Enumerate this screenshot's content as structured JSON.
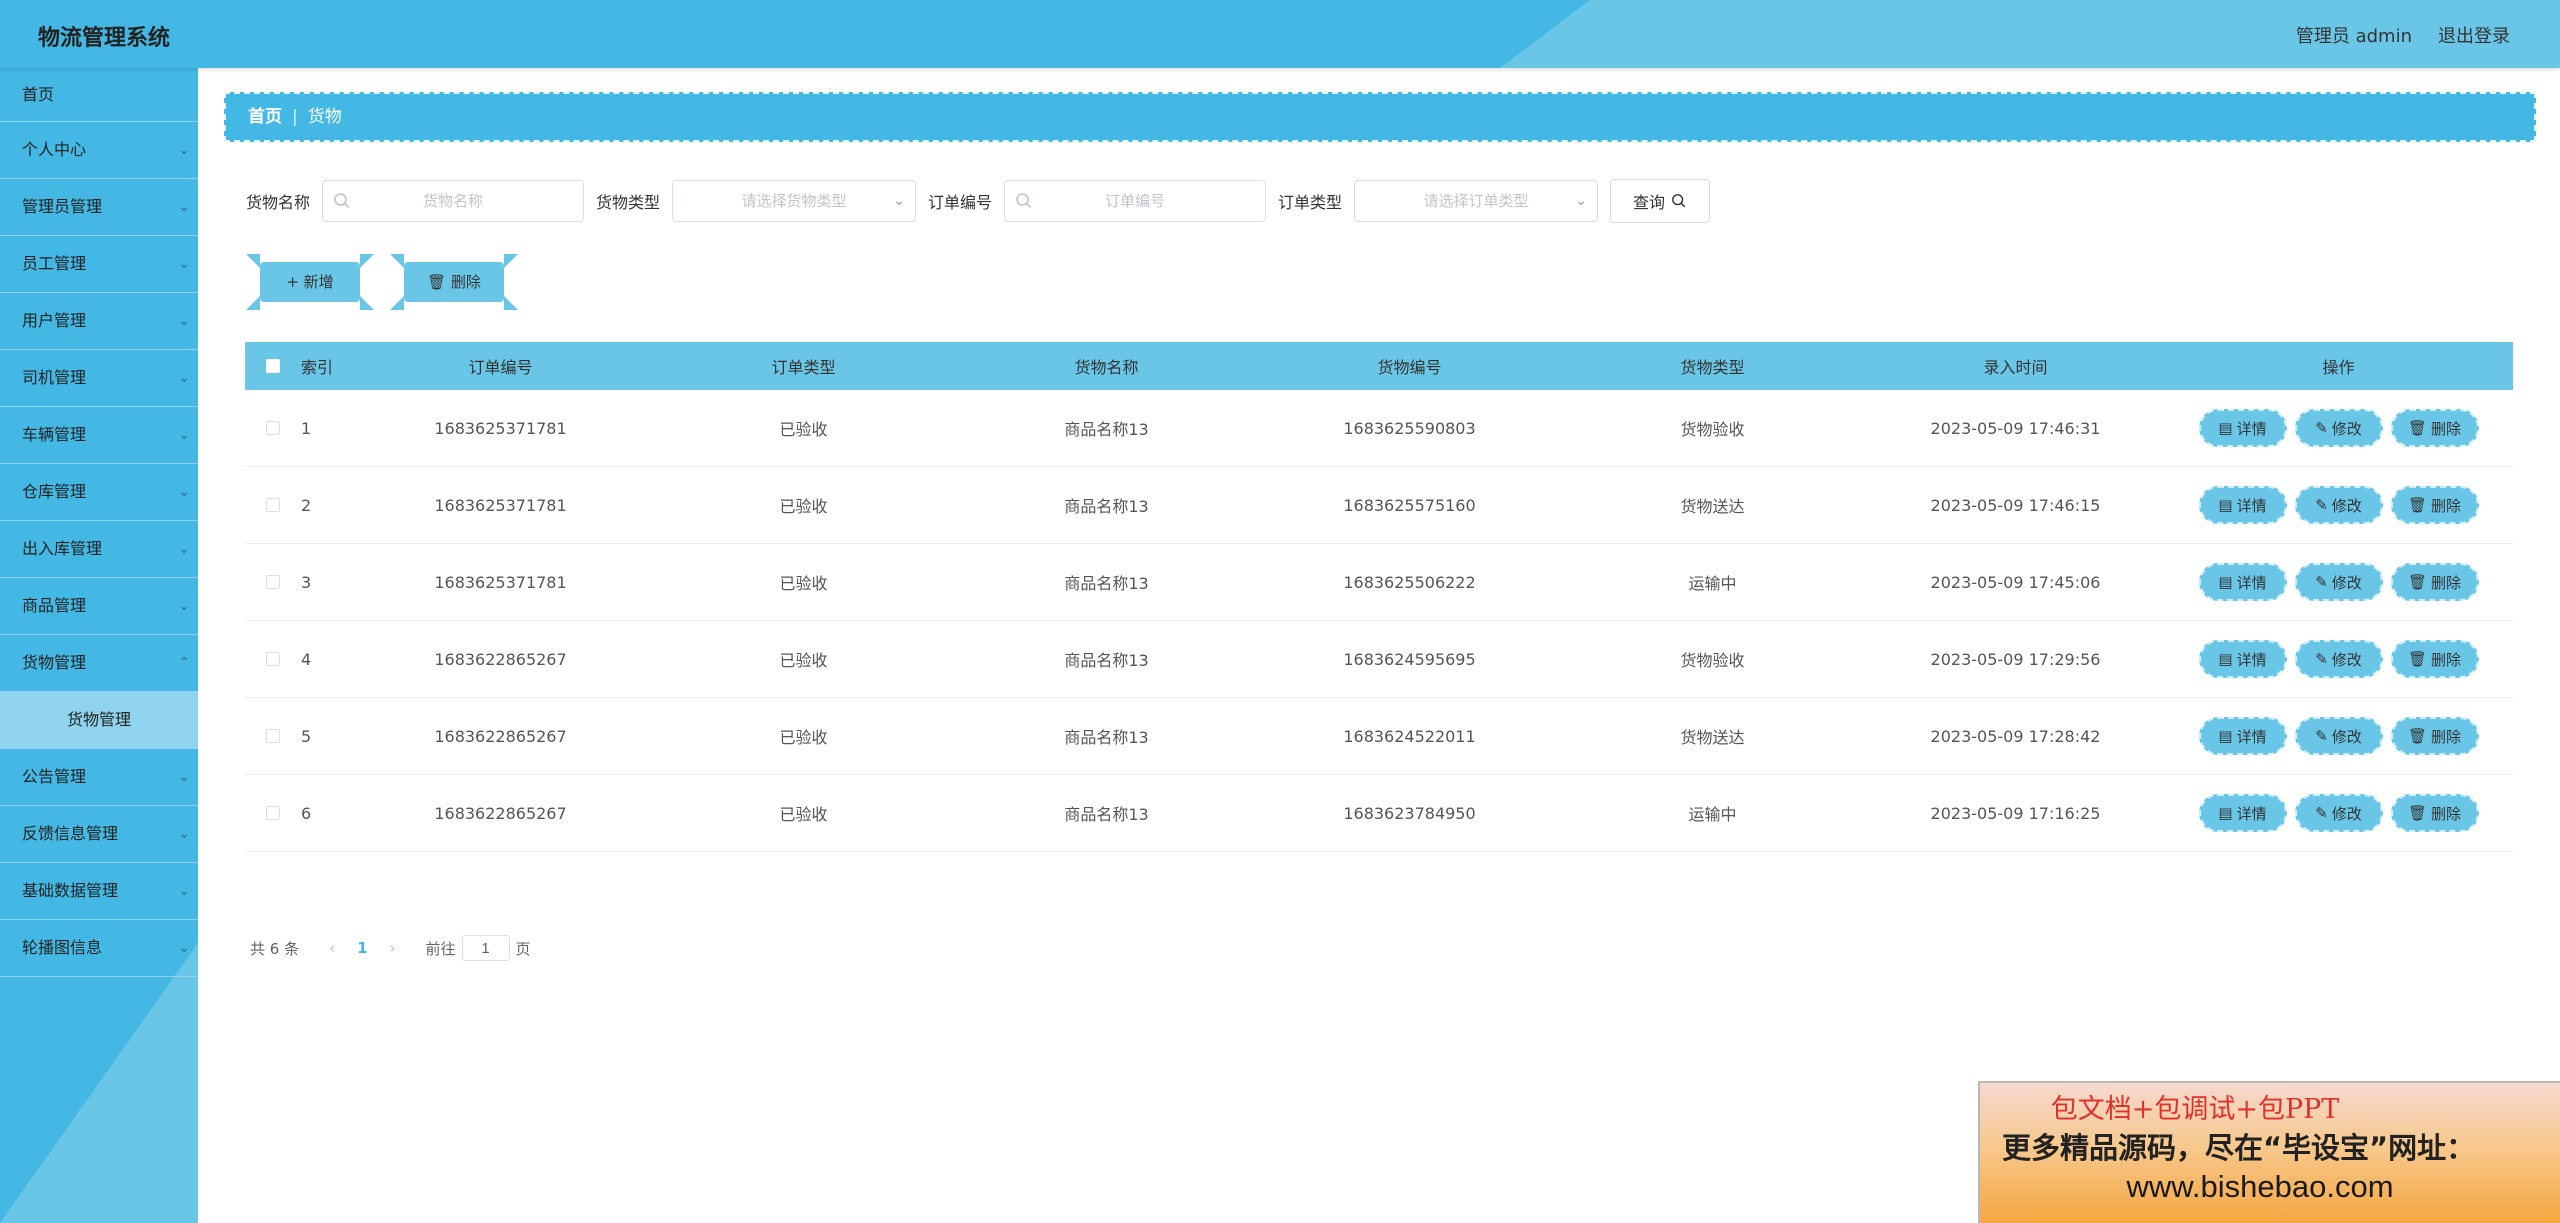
{
  "header": {
    "title": "物流管理系统",
    "user": "管理员 admin",
    "logout": "退出登录"
  },
  "sidebar": {
    "items": [
      {
        "label": "首页"
      },
      {
        "label": "个人中心"
      },
      {
        "label": "管理员管理"
      },
      {
        "label": "员工管理"
      },
      {
        "label": "用户管理"
      },
      {
        "label": "司机管理"
      },
      {
        "label": "车辆管理"
      },
      {
        "label": "仓库管理"
      },
      {
        "label": "出入库管理"
      },
      {
        "label": "商品管理"
      },
      {
        "label": "货物管理"
      },
      {
        "label": "公告管理"
      },
      {
        "label": "反馈信息管理"
      },
      {
        "label": "基础数据管理"
      },
      {
        "label": "轮播图信息"
      }
    ],
    "active_sub": "货物管理"
  },
  "breadcrumb": {
    "home": "首页",
    "current": "货物"
  },
  "filters": {
    "goods_name_label": "货物名称",
    "goods_name_placeholder": "货物名称",
    "goods_type_label": "货物类型",
    "goods_type_placeholder": "请选择货物类型",
    "order_no_label": "订单编号",
    "order_no_placeholder": "订单编号",
    "order_type_label": "订单类型",
    "order_type_placeholder": "请选择订单类型",
    "query_label": "查询"
  },
  "actions": {
    "add": "新增",
    "delete": "删除"
  },
  "table": {
    "columns": [
      "索引",
      "订单编号",
      "订单类型",
      "货物名称",
      "货物编号",
      "货物类型",
      "录入时间",
      "操作"
    ],
    "rows": [
      {
        "idx": "1",
        "order_no": "1683625371781",
        "order_type": "已验收",
        "goods_name": "商品名称13",
        "goods_no": "1683625590803",
        "goods_type": "货物验收",
        "time": "2023-05-09 17:46:31"
      },
      {
        "idx": "2",
        "order_no": "1683625371781",
        "order_type": "已验收",
        "goods_name": "商品名称13",
        "goods_no": "1683625575160",
        "goods_type": "货物送达",
        "time": "2023-05-09 17:46:15"
      },
      {
        "idx": "3",
        "order_no": "1683625371781",
        "order_type": "已验收",
        "goods_name": "商品名称13",
        "goods_no": "1683625506222",
        "goods_type": "运输中",
        "time": "2023-05-09 17:45:06"
      },
      {
        "idx": "4",
        "order_no": "1683622865267",
        "order_type": "已验收",
        "goods_name": "商品名称13",
        "goods_no": "1683624595695",
        "goods_type": "货物验收",
        "time": "2023-05-09 17:29:56"
      },
      {
        "idx": "5",
        "order_no": "1683622865267",
        "order_type": "已验收",
        "goods_name": "商品名称13",
        "goods_no": "1683624522011",
        "goods_type": "货物送达",
        "time": "2023-05-09 17:28:42"
      },
      {
        "idx": "6",
        "order_no": "1683622865267",
        "order_type": "已验收",
        "goods_name": "商品名称13",
        "goods_no": "1683623784950",
        "goods_type": "运输中",
        "time": "2023-05-09 17:16:25"
      }
    ],
    "ops": {
      "detail": "详情",
      "edit": "修改",
      "delete": "删除"
    }
  },
  "pager": {
    "total": "共 6 条",
    "current_page": "1",
    "goto_label": "前往",
    "goto_value": "1",
    "page_suffix": "页"
  },
  "ad": {
    "line1": "包文档+包调试+包PPT",
    "line2": "更多精品源码，尽在“毕设宝”网址：",
    "line3": "www.bishebao.com"
  },
  "colors": {
    "primary": "#43b8e4",
    "light": "#6ac6e6",
    "accent_red": "#e0302a"
  }
}
